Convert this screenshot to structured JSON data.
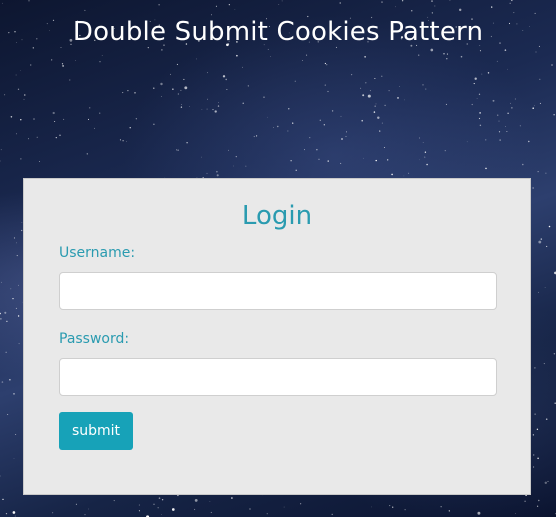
{
  "page": {
    "title": "Double Submit Cookies Pattern"
  },
  "login": {
    "heading": "Login",
    "username_label": "Username:",
    "username_value": "",
    "password_label": "Password:",
    "password_value": "",
    "submit_label": "submit"
  },
  "colors": {
    "accent": "#17a2b8",
    "label_text": "#2a9bb0",
    "card_background": "#e9e9e9",
    "page_title_text": "#ffffff"
  }
}
